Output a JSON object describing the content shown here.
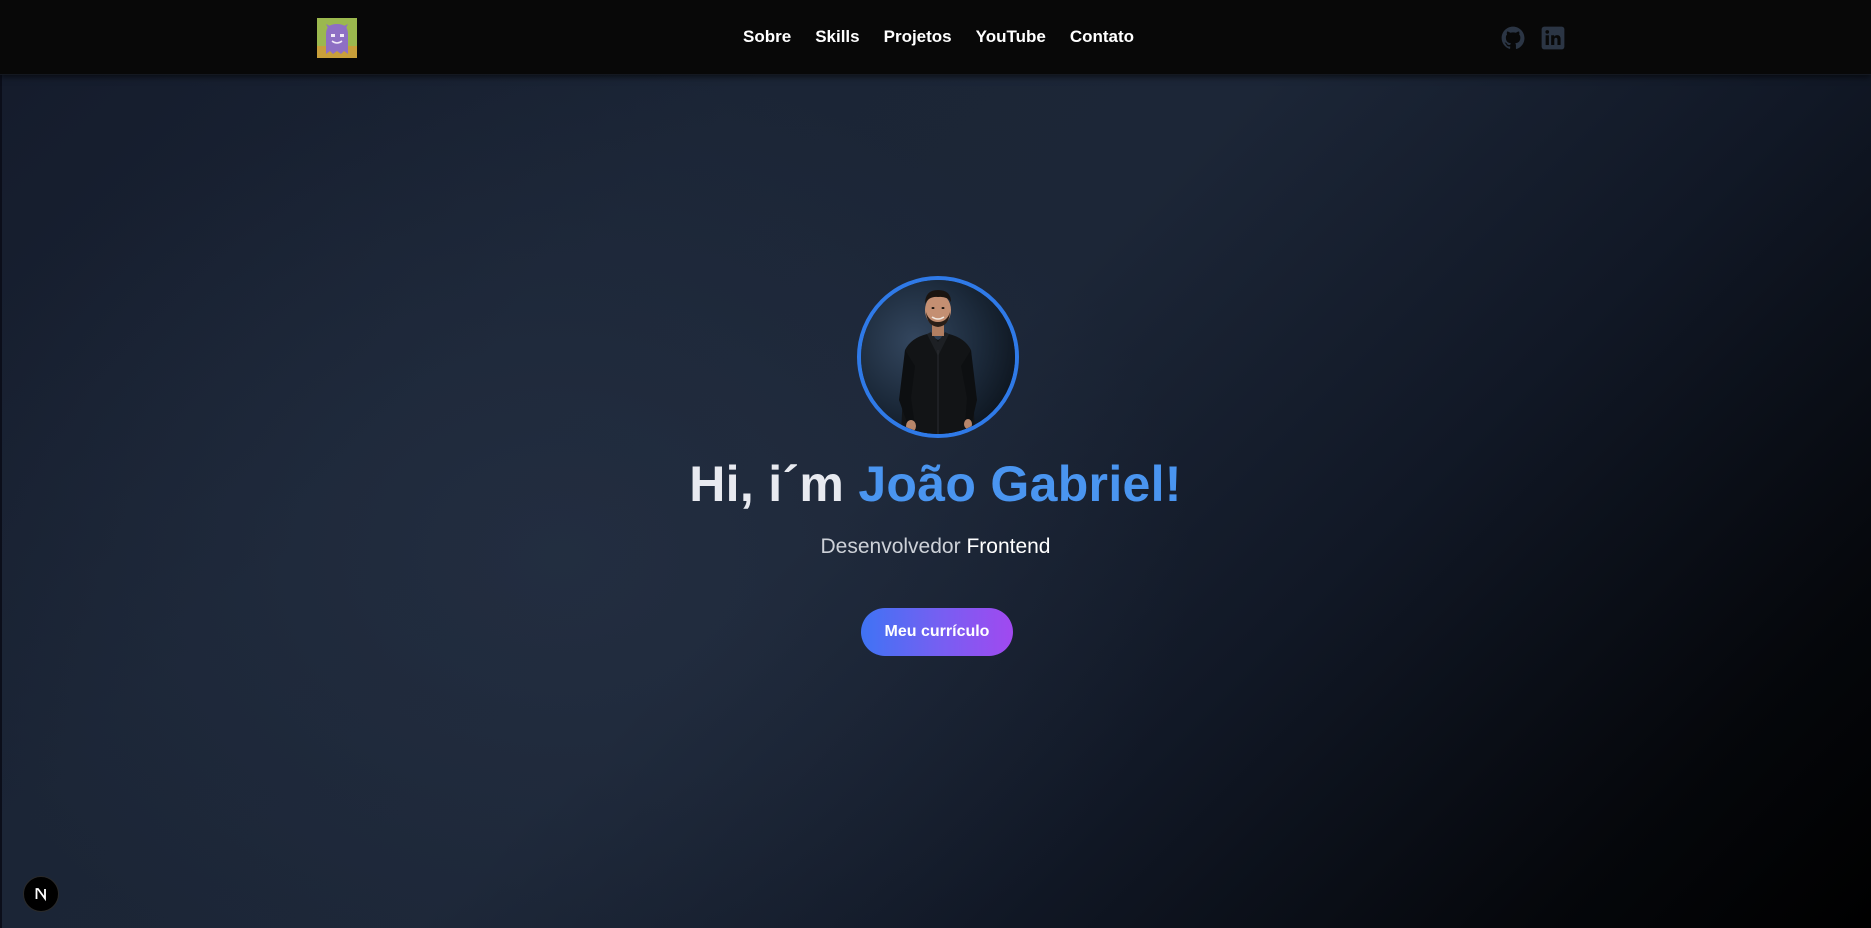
{
  "header": {
    "nav": [
      {
        "label": "Sobre"
      },
      {
        "label": "Skills"
      },
      {
        "label": "Projetos"
      },
      {
        "label": "YouTube"
      },
      {
        "label": "Contato"
      }
    ],
    "social": {
      "github_icon": "github-icon",
      "linkedin_icon": "linkedin-icon",
      "icon_color": "#2b3544"
    }
  },
  "hero": {
    "greeting": "Hi, i´m",
    "name": "João Gabriel!",
    "role_prefix": "Desenvolvedor",
    "role_strong": "Frontend",
    "cta_label": "Meu currículo",
    "accent_color": "#4a95f0",
    "avatar_border_color": "#2f7ae8"
  },
  "dev_badge": {
    "label": "N"
  }
}
